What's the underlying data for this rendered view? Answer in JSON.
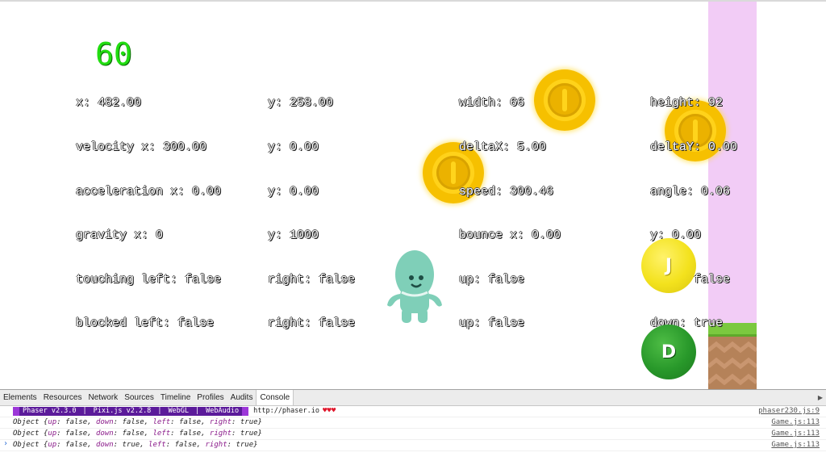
{
  "game": {
    "fps": "60",
    "debug": {
      "col1": [
        "x: 482.00",
        "velocity x: 300.00",
        "acceleration x: 0.00",
        "gravity x: 0",
        "touching left: false",
        "blocked left: false"
      ],
      "col2": [
        "y: 258.00",
        "y: 0.00",
        "y: 0.00",
        "y: 1000",
        "right: false",
        "right: false"
      ],
      "col3": [
        "width: 66",
        "deltaX: 5.00",
        "speed: 300.46",
        "bounce x: 0.00",
        "up: false",
        "up: false"
      ],
      "col4": [
        "height: 92",
        "deltaY: 0.00",
        "angle: 0.06",
        "y: 0.00",
        "down: false",
        "down: true"
      ]
    },
    "buttons": {
      "jump_label": "J",
      "down_label": "D"
    },
    "colors": {
      "fps": "#22dd11",
      "coin": "#f6c000",
      "pink_column": "#f2ccf6",
      "grass": "#7bc93f",
      "dirt": "#b58259",
      "alien": "#7fcfb8",
      "jump_button": "#f3e21d",
      "down_button": "#28982a"
    }
  },
  "devtools": {
    "tabs": [
      "Elements",
      "Resources",
      "Network",
      "Sources",
      "Timeline",
      "Profiles",
      "Audits",
      "Console"
    ],
    "active_tab": "Console",
    "banner": {
      "segments": [
        "Phaser v2.3.0",
        "Pixi.js v2.2.8",
        "WebGL",
        "WebAudio"
      ],
      "url": "http://phaser.io",
      "hearts": "♥♥♥",
      "source": "phaser230.js:9"
    },
    "logs": [
      {
        "up": "false",
        "down": "false",
        "left": "false",
        "right": "true",
        "source": "Game.js:113"
      },
      {
        "up": "false",
        "down": "false",
        "left": "false",
        "right": "true",
        "source": "Game.js:113"
      },
      {
        "up": "false",
        "down": "true",
        "left": "false",
        "right": "true",
        "source": "Game.js:113"
      }
    ],
    "prompt_symbol": "›"
  }
}
